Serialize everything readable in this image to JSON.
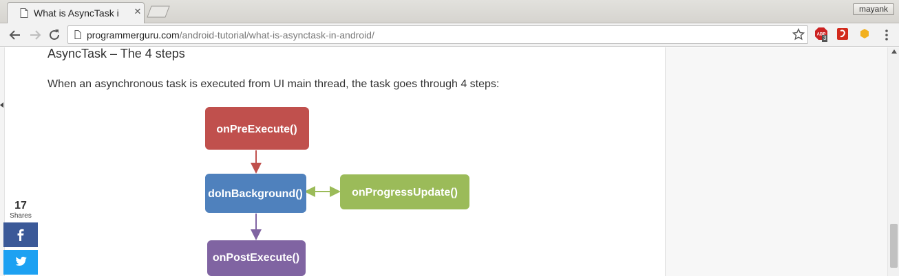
{
  "browser": {
    "tab_title": "What is AsyncTask i",
    "profile_name": "mayank",
    "url_host": "programmerguru.com",
    "url_path": "/android-tutorial/what-is-asynctask-in-android/",
    "abp_badge": "3"
  },
  "article": {
    "heading": "AsyncTask – The 4 steps",
    "intro": "When an asynchronous task is executed from UI main thread, the task goes through 4 steps:"
  },
  "diagram": {
    "nodes": [
      {
        "id": "pre",
        "label": "onPreExecute()",
        "color": "#c0504d"
      },
      {
        "id": "bg",
        "label": "doInBackground()",
        "color": "#4f81bd"
      },
      {
        "id": "progress",
        "label": "onProgressUpdate()",
        "color": "#9bbb59"
      },
      {
        "id": "post",
        "label": "onPostExecute()",
        "color": "#8064a2"
      }
    ]
  },
  "share": {
    "count": "17",
    "label": "Shares",
    "facebook_icon": "facebook-icon",
    "twitter_icon": "twitter-icon"
  }
}
